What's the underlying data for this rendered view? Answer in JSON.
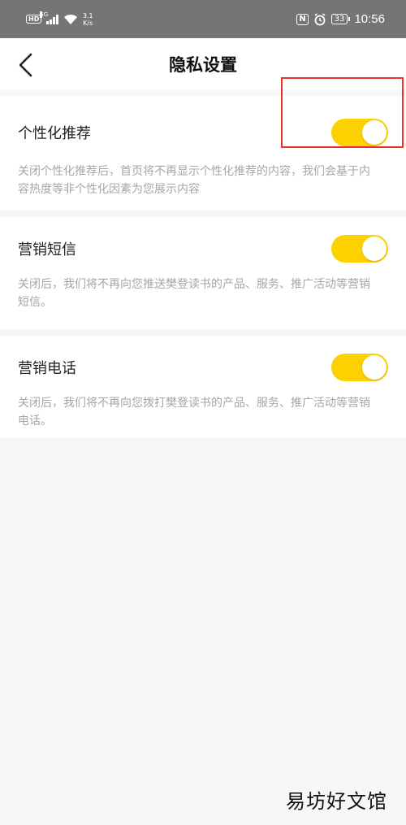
{
  "status_bar": {
    "hd": "HD",
    "network_type": "5G",
    "speed_value": "3.1",
    "speed_unit": "K/s",
    "nfc": "N",
    "battery": "33",
    "time": "10:56"
  },
  "nav": {
    "title": "隐私设置"
  },
  "settings": [
    {
      "title": "个性化推荐",
      "enabled": true,
      "description": "关闭个性化推荐后，首页将不再显示个性化推荐的内容，我们会基于内容热度等非个性化因素为您展示内容"
    },
    {
      "title": "营销短信",
      "enabled": true,
      "description": "关闭后，我们将不再向您推送樊登读书的产品、服务、推广活动等营销短信。"
    },
    {
      "title": "营销电话",
      "enabled": true,
      "description": "关闭后，我们将不再向您拨打樊登读书的产品、服务、推广活动等营销电话。"
    }
  ],
  "colors": {
    "toggle_on": "#fdd000",
    "highlight": "#e5322d",
    "status_bar": "#757575"
  },
  "watermark": "易坊好文馆"
}
